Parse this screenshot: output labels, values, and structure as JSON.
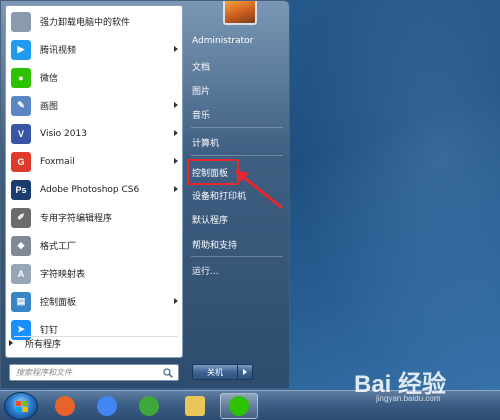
{
  "start_menu": {
    "programs": [
      {
        "label": "强力卸载电脑中的软件",
        "icon": "uninstall-tool-icon",
        "color": "#8a9bb0",
        "glyph": "",
        "arrow": false
      },
      {
        "label": "腾讯视频",
        "icon": "tencent-video-icon",
        "color": "#1e9bf0",
        "glyph": "▶",
        "arrow": true
      },
      {
        "label": "微信",
        "icon": "wechat-icon",
        "color": "#2dc100",
        "glyph": "●",
        "arrow": false
      },
      {
        "label": "画图",
        "icon": "paint-icon",
        "color": "#5a86c4",
        "glyph": "✎",
        "arrow": true
      },
      {
        "label": "Visio 2013",
        "icon": "visio-icon",
        "color": "#3955a3",
        "glyph": "V",
        "arrow": true
      },
      {
        "label": "Foxmail",
        "icon": "foxmail-icon",
        "color": "#e03a2d",
        "glyph": "G",
        "arrow": true
      },
      {
        "label": "Adobe Photoshop CS6",
        "icon": "photoshop-icon",
        "color": "#1b3c6e",
        "glyph": "Ps",
        "arrow": true
      },
      {
        "label": "专用字符编辑程序",
        "icon": "char-editor-icon",
        "color": "#6b6b6b",
        "glyph": "✐",
        "arrow": false
      },
      {
        "label": "格式工厂",
        "icon": "format-factory-icon",
        "color": "#7f8a96",
        "glyph": "◆",
        "arrow": false
      },
      {
        "label": "字符映射表",
        "icon": "charmap-icon",
        "color": "#97a6b6",
        "glyph": "A",
        "arrow": false
      },
      {
        "label": "控制面板",
        "icon": "control-panel-icon",
        "color": "#3a84c8",
        "glyph": "▤",
        "arrow": true
      },
      {
        "label": "钉钉",
        "icon": "dingtalk-icon",
        "color": "#1890ff",
        "glyph": "➤",
        "arrow": false
      }
    ],
    "all_programs_label": "所有程序",
    "search_placeholder": "搜索程序和文件",
    "right_items": {
      "user": "Administrator",
      "documents": "文档",
      "pictures": "图片",
      "music": "音乐",
      "computer": "计算机",
      "control_panel": "控制面板",
      "devices_printers": "设备和打印机",
      "default_programs": "默认程序",
      "help_support": "帮助和支持",
      "run": "运行..."
    },
    "shutdown_label": "关机"
  },
  "taskbar": {
    "apps": [
      {
        "name": "firefox-taskbar-icon",
        "color": "#e8632a",
        "active": false
      },
      {
        "name": "chrome-taskbar-icon",
        "color": "#4285f4",
        "active": false
      },
      {
        "name": "refresh-app-taskbar-icon",
        "color": "#3ea83a",
        "active": false
      },
      {
        "name": "file-explorer-taskbar-icon",
        "color": "#e9c65a",
        "active": false
      },
      {
        "name": "wechat-taskbar-icon",
        "color": "#2dc100",
        "active": true
      }
    ]
  },
  "watermark": {
    "logo": "Bai 经验",
    "url": "jingyan.baidu.com"
  },
  "colors": {
    "highlight": "#e8262c"
  }
}
